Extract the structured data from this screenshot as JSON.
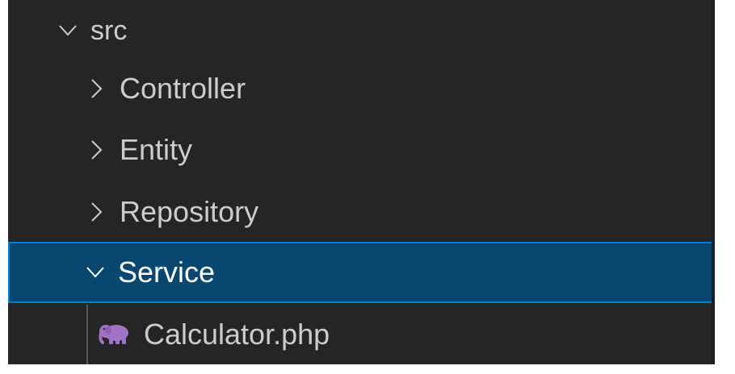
{
  "explorer": {
    "tree": {
      "root": {
        "label": "src",
        "expanded": true
      },
      "folders": [
        {
          "label": "Controller",
          "expanded": false
        },
        {
          "label": "Entity",
          "expanded": false
        },
        {
          "label": "Repository",
          "expanded": false
        },
        {
          "label": "Service",
          "expanded": true,
          "selected": true
        }
      ],
      "files": [
        {
          "label": "Calculator.php",
          "icon": "php-elephant-icon"
        }
      ]
    },
    "colors": {
      "background": "#252526",
      "text": "#cccccc",
      "selection_bg": "#094771",
      "selection_border": "#007fd4",
      "php_icon": "#a074c4"
    }
  }
}
